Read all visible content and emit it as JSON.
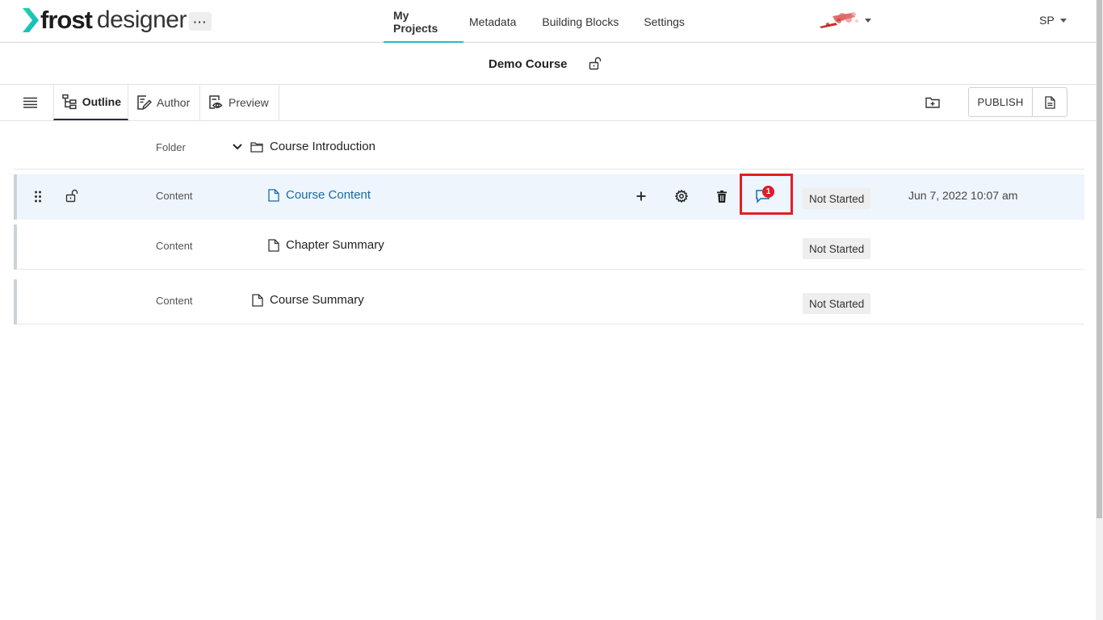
{
  "app": {
    "logo_bold": "frost",
    "logo_light": "designer",
    "more_label": "···",
    "nav": [
      {
        "label": "My Projects",
        "active": true
      },
      {
        "label": "Metadata",
        "active": false
      },
      {
        "label": "Building Blocks",
        "active": false
      },
      {
        "label": "Settings",
        "active": false
      }
    ],
    "user_initials": "SP",
    "accent_color": "#2bb7d4",
    "logo_color": "#15c7a4"
  },
  "course": {
    "title": "Demo Course"
  },
  "toolbar": {
    "tabs": [
      {
        "label": "Outline",
        "icon": "outline-icon",
        "active": true
      },
      {
        "label": "Author",
        "icon": "author-icon",
        "active": false
      },
      {
        "label": "Preview",
        "icon": "preview-icon",
        "active": false
      }
    ],
    "publish_label": "PUBLISH"
  },
  "outline": {
    "folder": {
      "type": "Folder",
      "name": "Course Introduction"
    },
    "rows": [
      {
        "type": "Content",
        "name": "Course Content",
        "status": "Not Started",
        "date": "Jun 7, 2022 10:07 am",
        "comment_count": "1"
      },
      {
        "type": "Content",
        "name": "Chapter Summary",
        "status": "Not Started"
      },
      {
        "type": "Content",
        "name": "Course Summary",
        "status": "Not Started"
      }
    ]
  }
}
